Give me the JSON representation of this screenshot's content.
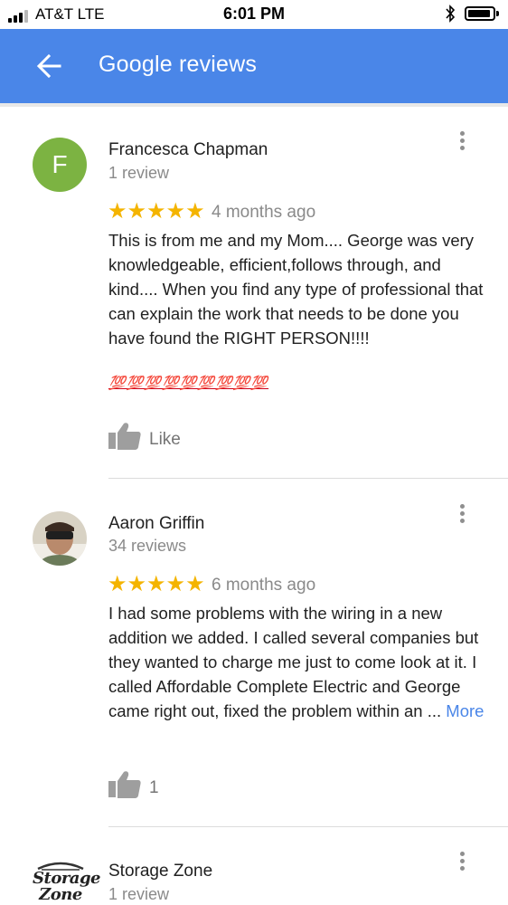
{
  "status_bar": {
    "carrier": "AT&T  LTE",
    "time": "6:01 PM"
  },
  "header": {
    "title": "Google reviews",
    "accent_color": "#4a86e8"
  },
  "reviews": [
    {
      "avatar_letter": "F",
      "name": "Francesca Chapman",
      "review_count": "1 review",
      "rating": 5,
      "stars": "★★★★★",
      "time_ago": "4 months ago",
      "text": "This is from me and my Mom.... George was very knowledgeable, efficient,follows through, and kind.... When you find any type of professional that can explain the work that needs to be done you have found the RIGHT PERSON!!!!",
      "emoji": "💯💯💯💯💯💯💯💯💯",
      "like_label": "Like"
    },
    {
      "name": "Aaron Griffin",
      "review_count": "34 reviews",
      "rating": 5,
      "stars": "★★★★★",
      "time_ago": "6 months ago",
      "text": "I had some problems with the wiring in a new addition we added. I called several companies but they wanted to charge me just to come look at it. I called Affordable Complete Electric and George came right out, fixed the problem within an ...",
      "more_label": "More",
      "like_count": "1"
    },
    {
      "logo_text": "Storage Zone",
      "name": "Storage Zone",
      "review_count": "1 review"
    }
  ]
}
